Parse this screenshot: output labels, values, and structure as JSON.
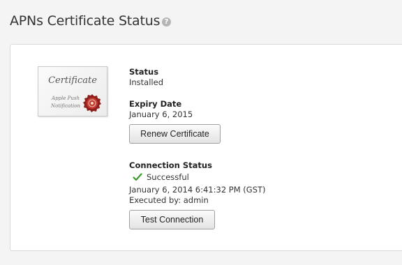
{
  "header": {
    "title": "APNs Certificate Status",
    "help_icon": "question-icon",
    "help_glyph": "?"
  },
  "certificate_image": {
    "title": "Certificate",
    "line1": "Apple Push",
    "line2": "Notification",
    "seal_color": "#b0302a"
  },
  "status": {
    "label": "Status",
    "value": "Installed"
  },
  "expiry": {
    "label": "Expiry Date",
    "value": "January 6, 2015",
    "button": "Renew Certificate"
  },
  "connection": {
    "label": "Connection Status",
    "result": "Successful",
    "result_icon": "check-icon",
    "result_color": "#3a9a2a",
    "timestamp": "January 6, 2014 6:41:32 PM (GST)",
    "executed_by": "Executed by: admin",
    "button": "Test Connection"
  }
}
